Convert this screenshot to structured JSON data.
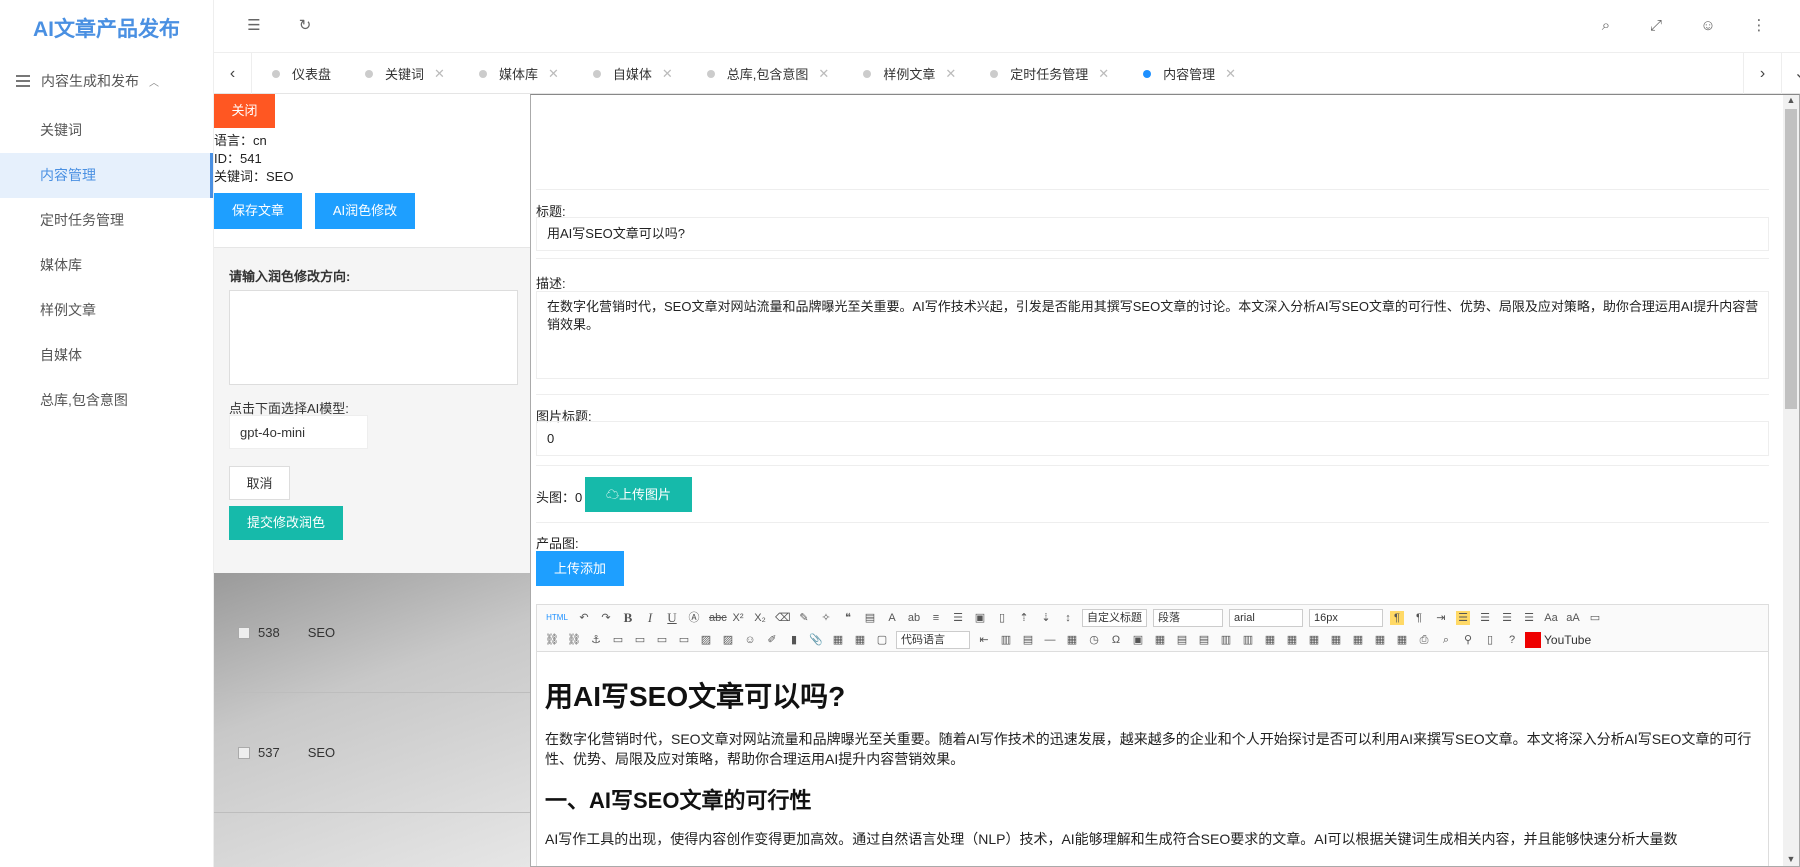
{
  "app": {
    "title": "AI文章产品发布"
  },
  "sidebar": {
    "group_label": "内容生成和发布",
    "items": [
      {
        "label": "关键词"
      },
      {
        "label": "内容管理"
      },
      {
        "label": "定时任务管理"
      },
      {
        "label": "媒体库"
      },
      {
        "label": "样例文章"
      },
      {
        "label": "自媒体"
      },
      {
        "label": "总库,包含意图"
      }
    ]
  },
  "topbar": {
    "icons": [
      "menu-fold-icon",
      "refresh-icon",
      "search-icon",
      "fullscreen-icon",
      "user-icon",
      "more-icon"
    ]
  },
  "tabs": [
    {
      "label": "仪表盘",
      "active": false
    },
    {
      "label": "关键词",
      "active": false
    },
    {
      "label": "媒体库",
      "active": false
    },
    {
      "label": "自媒体",
      "active": false
    },
    {
      "label": "总库,包含意图",
      "active": false
    },
    {
      "label": "样例文章",
      "active": false
    },
    {
      "label": "定时任务管理",
      "active": false
    },
    {
      "label": "内容管理",
      "active": true
    }
  ],
  "left": {
    "close_label": "关闭",
    "language": "语言：cn",
    "id": "ID：541",
    "keyword": "关键词：SEO",
    "save_label": "保存文章",
    "ai_label": "AI润色修改",
    "polish": {
      "label": "请输入润色修改方向:",
      "model_label": "点击下面选择AI模型:",
      "model_value": "gpt-4o-mini",
      "cancel_label": "取消",
      "submit_label": "提交修改润色"
    },
    "rows": [
      {
        "id": "538",
        "keyword": "SEO"
      },
      {
        "id": "537",
        "keyword": "SEO"
      }
    ]
  },
  "form": {
    "title_label": "标题:",
    "title_value": "用AI写SEO文章可以吗?",
    "desc_label": "描述:",
    "desc_value": "在数字化营销时代，SEO文章对网站流量和品牌曝光至关重要。AI写作技术兴起，引发是否能用其撰写SEO文章的讨论。本文深入分析AI写SEO文章的可行性、优势、局限及应对策略，助你合理运用AI提升内容营销效果。",
    "img_title_label": "图片标题:",
    "img_title_value": "0",
    "head_img_label": "头图：0",
    "upload_img_label": "上传图片",
    "product_img_label": "产品图:",
    "upload_add_label": "上传添加"
  },
  "editor": {
    "toolbar": {
      "custom_heading": "自定义标题",
      "paragraph": "段落",
      "font": "arial",
      "size": "16px",
      "code_lang": "代码语言",
      "youtube": "YouTube"
    },
    "doc": {
      "h1": "用AI写SEO文章可以吗?",
      "p1": "在数字化营销时代，SEO文章对网站流量和品牌曝光至关重要。随着AI写作技术的迅速发展，越来越多的企业和个人开始探讨是否可以利用AI来撰写SEO文章。本文将深入分析AI写SEO文章的可行性、优势、局限及应对策略，帮助你合理运用AI提升内容营销效果。",
      "h2": "一、AI写SEO文章的可行性",
      "p2": "AI写作工具的出现，使得内容创作变得更加高效。通过自然语言处理（NLP）技术，AI能够理解和生成符合SEO要求的文章。AI可以根据关键词生成相关内容，并且能够快速分析大量数"
    }
  }
}
